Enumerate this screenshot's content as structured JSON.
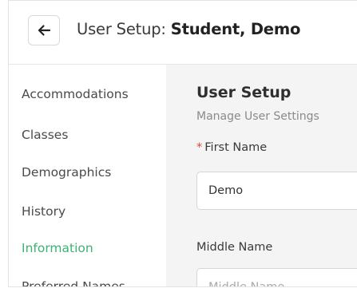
{
  "header": {
    "back_icon": "arrow-left-icon",
    "title_prefix": "User Setup: ",
    "title_subject": "Student, Demo"
  },
  "sidebar": {
    "items": [
      {
        "label": "Accommodations",
        "active": false
      },
      {
        "label": "Classes",
        "active": false
      },
      {
        "label": "Demographics",
        "active": false
      },
      {
        "label": "History",
        "active": false
      },
      {
        "label": "Information",
        "active": true
      },
      {
        "label": "Preferred Names",
        "active": false
      }
    ]
  },
  "main": {
    "title": "User Setup",
    "subtitle": "Manage User Settings",
    "fields": {
      "first_name": {
        "required_marker": "*",
        "label": "First Name",
        "value": "Demo"
      },
      "middle_name": {
        "label": "Middle Name",
        "value": "",
        "placeholder": "Middle Name"
      }
    }
  },
  "colors": {
    "accent_active": "#3cb371",
    "required": "#e0463c",
    "content_bg": "#f4f4f4"
  }
}
